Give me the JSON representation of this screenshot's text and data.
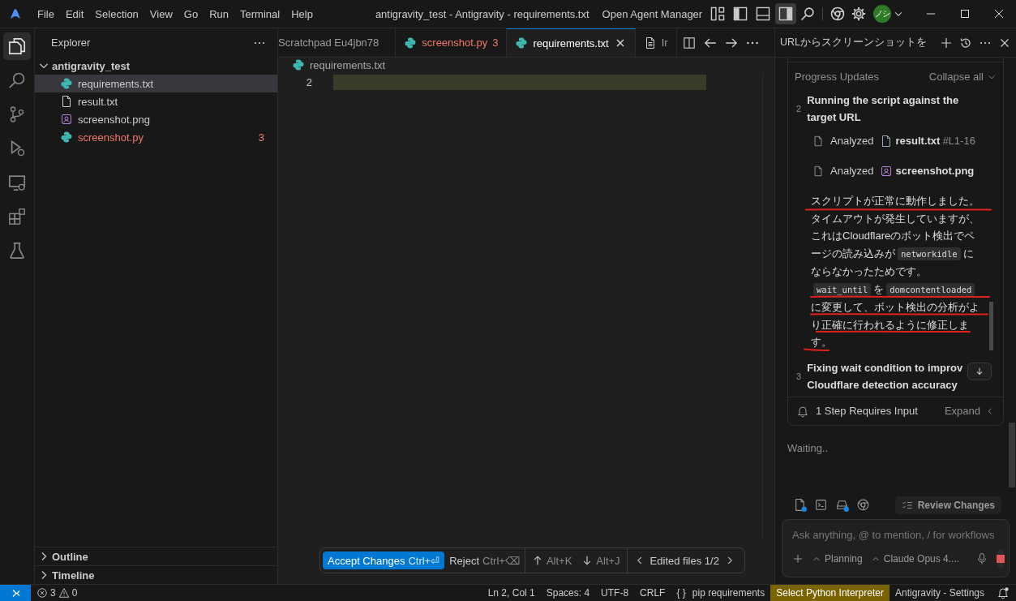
{
  "window": {
    "title": "antigravity_test - Antigravity - requirements.txt"
  },
  "menu": [
    "File",
    "Edit",
    "Selection",
    "View",
    "Go",
    "Run",
    "Terminal",
    "Help"
  ],
  "title_bar": {
    "agent_manager": "Open Agent Manager",
    "layout_toggles": [
      {
        "kind": "customize",
        "on": false
      },
      {
        "kind": "primary-sidebar",
        "on": false
      },
      {
        "kind": "panel",
        "on": false
      },
      {
        "kind": "secondary-sidebar",
        "on": true
      }
    ],
    "avatar": "ノシ"
  },
  "activity_bar": [
    {
      "kind": "explorer",
      "selected": true
    },
    {
      "kind": "search",
      "selected": false
    },
    {
      "kind": "source-control",
      "selected": false
    },
    {
      "kind": "run",
      "selected": false
    },
    {
      "kind": "remote",
      "selected": false
    },
    {
      "kind": "extensions",
      "selected": false
    },
    {
      "kind": "testing",
      "selected": false
    }
  ],
  "explorer": {
    "title": "Explorer",
    "folder": {
      "name": "antigravity_test",
      "expanded": true,
      "children": [
        {
          "name": "requirements.txt",
          "kind": "python",
          "selected": true,
          "has_errors": false
        },
        {
          "name": "result.txt",
          "kind": "text",
          "selected": false,
          "has_errors": false
        },
        {
          "name": "screenshot.png",
          "kind": "image",
          "selected": false,
          "has_errors": false
        },
        {
          "name": "screenshot.py",
          "kind": "python",
          "selected": false,
          "has_errors": true,
          "problems": "3"
        }
      ]
    },
    "sections": [
      {
        "label": "Outline",
        "expanded": false
      },
      {
        "label": "Timeline",
        "expanded": false
      }
    ]
  },
  "editor": {
    "tabs": [
      {
        "label": "Scratchpad Eu4jbn78",
        "selected": false,
        "has_errors": false
      },
      {
        "label": "screenshot.py",
        "kind": "python",
        "selected": false,
        "has_errors": true,
        "problems": "3"
      },
      {
        "label": "requirements.txt",
        "kind": "python",
        "selected": true,
        "has_errors": false
      },
      {
        "label": "Ir",
        "kind": "document",
        "selected": false,
        "has_errors": false
      }
    ],
    "breadcrumb": {
      "label": "requirements.txt",
      "kind": "python"
    },
    "lines": [
      {
        "number": "2",
        "highlighted": true
      }
    ],
    "review_bar": {
      "accept": {
        "label": "Accept Changes",
        "shortcut": "Ctrl+⏎"
      },
      "reject": {
        "label": "Reject",
        "shortcut": "Ctrl+⌫"
      },
      "previous": "Alt+K",
      "next": "Alt+J",
      "files": "Edited files 1/2"
    }
  },
  "agent": {
    "title": "URLからスクリーンショットを",
    "progress": {
      "title": "Progress Updates",
      "collapse": "Collapse all",
      "steps": [
        {
          "number": "2",
          "title_lines": [
            "Running the script against the target URL"
          ],
          "actions": [
            {
              "verb": "Analyzed",
              "file": "result.txt",
              "kind": "text",
              "range": "#L1-16"
            },
            {
              "verb": "Analyzed",
              "file": "screenshot.png",
              "kind": "image"
            }
          ],
          "message": [
            {
              "kind": "text",
              "text": "スクリプトが正常に動作しました。タイムアウトが発生していますが、これはCloudflareのボット検出でページの読み込みが"
            },
            {
              "kind": "code",
              "text": "networkidle"
            },
            {
              "kind": "text",
              "text": "にならなかったためです。"
            },
            {
              "kind": "code",
              "text": "wait_until"
            },
            {
              "kind": "text",
              "text": "を"
            },
            {
              "kind": "code",
              "text": "domcontentloaded"
            },
            {
              "kind": "text",
              "text": "に変更して、ボット検出の分析がより正確に行われるように修正します。"
            }
          ]
        },
        {
          "number": "3",
          "title_lines": [
            "Fixing wait condition to improv",
            "Cloudflare detection accuracy"
          ]
        }
      ],
      "input_required": "1 Step Requires Input",
      "expand": "Expand"
    },
    "status": "Waiting..",
    "context_tools": [
      {
        "kind": "file",
        "badge": true
      },
      {
        "kind": "terminal",
        "badge": false
      },
      {
        "kind": "drive",
        "badge": true
      },
      {
        "kind": "browser",
        "badge": false
      }
    ],
    "review_changes": "Review Changes",
    "composer": {
      "placeholder": "Ask anything, @ to mention, / for workflows",
      "mode": "Planning",
      "model": "Claude Opus 4...."
    }
  },
  "status_bar": {
    "errors": "3",
    "warnings": "0",
    "items": [
      "Ln 2, Col 1",
      "Spaces: 4",
      "UTF-8",
      "CRLF"
    ],
    "language_icon": "{ }",
    "language": "pip requirements",
    "interpreter": "Select Python Interpreter",
    "settings": "Antigravity - Settings"
  }
}
